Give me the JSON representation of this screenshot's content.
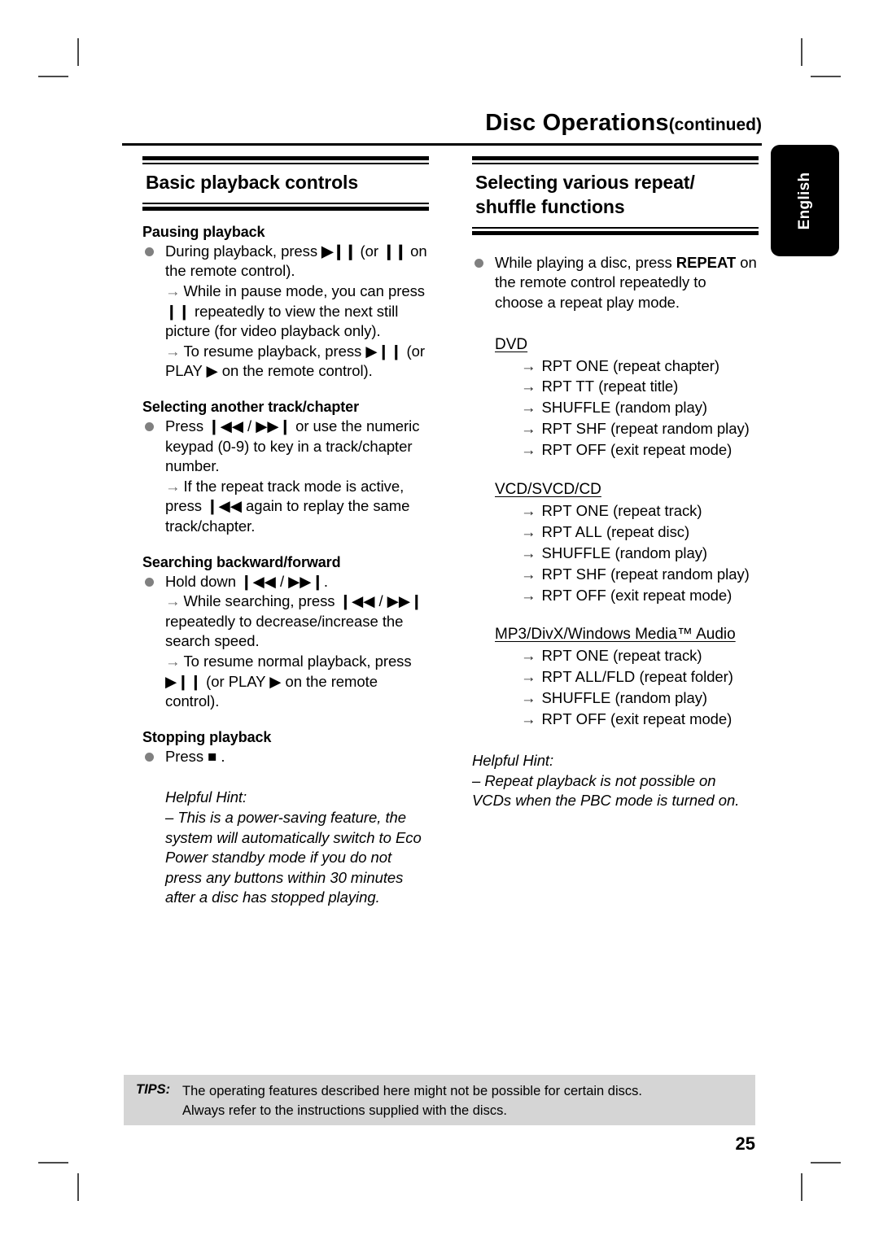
{
  "header": {
    "title_main": "Disc Operations",
    "title_continued": "(continued)"
  },
  "language_tab": {
    "label": "English"
  },
  "left_column": {
    "section_title": "Basic playback controls",
    "blocks": [
      {
        "heading": "Pausing playback",
        "bullet": "During playback, press ▶❙❙ (or ❙❙ on the remote control).",
        "bullet_parts": {
          "t1": "During playback, press ",
          "g1": "▶❙❙",
          "t2": " (or ",
          "g2": "❙❙",
          "t3": " on the remote control)."
        },
        "arrows": [
          "While in pause mode, you can press ❙❙ repeatedly to view the next still picture (for video playback only).",
          "To resume playback, press ▶❙❙ (or PLAY ▶ on the remote control)."
        ]
      },
      {
        "heading": "Selecting another track/chapter",
        "bullet": "Press ❙◀◀ / ▶▶❙ or use the numeric keypad (0-9) to key in a track/chapter number.",
        "arrows": [
          "If the repeat track mode is active, press ❙◀◀ again to replay the same track/chapter."
        ]
      },
      {
        "heading": "Searching backward/forward",
        "bullet": "Hold down ❙◀◀ / ▶▶❙.",
        "arrows": [
          "While searching, press ❙◀◀ / ▶▶❙ repeatedly to decrease/increase the search speed.",
          "To resume normal playback, press ▶❙❙ (or PLAY ▶ on the remote control)."
        ]
      },
      {
        "heading": "Stopping playback",
        "bullet": "Press ■ ."
      }
    ],
    "hint": {
      "label": "Helpful Hint:",
      "text": "– This is a power-saving feature, the system will automatically switch to Eco Power standby mode if you do not press any buttons within 30 minutes after a disc has stopped playing."
    }
  },
  "right_column": {
    "section_title": "Selecting various repeat/ shuffle functions",
    "section_title_line1": "Selecting various repeat/",
    "section_title_line2": "shuffle functions",
    "intro_bullet": {
      "t1": "While playing a disc, press ",
      "key": "REPEAT",
      "t2": " on the remote control repeatedly to choose a repeat play mode."
    },
    "repeat_groups": [
      {
        "disc_type": "DVD",
        "modes": [
          {
            "code": "RPT ONE",
            "desc": "(repeat chapter)"
          },
          {
            "code": "RPT TT",
            "desc": "(repeat title)"
          },
          {
            "code": "SHUFFLE",
            "desc": "(random play)"
          },
          {
            "code": "RPT SHF",
            "desc": "(repeat random play)"
          },
          {
            "code": "RPT OFF",
            "desc": "(exit repeat mode)"
          }
        ]
      },
      {
        "disc_type": "VCD/SVCD/CD",
        "modes": [
          {
            "code": "RPT ONE",
            "desc": "(repeat track)"
          },
          {
            "code": "RPT ALL",
            "desc": "(repeat disc)"
          },
          {
            "code": "SHUFFLE",
            "desc": "(random play)"
          },
          {
            "code": "RPT SHF",
            "desc": "(repeat random play)"
          },
          {
            "code": "RPT OFF",
            "desc": "(exit repeat mode)"
          }
        ]
      },
      {
        "disc_type": "MP3/DivX/Windows Media™ Audio",
        "modes": [
          {
            "code": "RPT ONE",
            "desc": "(repeat track)"
          },
          {
            "code": "RPT ALL/FLD",
            "desc": "(repeat folder)"
          },
          {
            "code": "SHUFFLE",
            "desc": "(random play)"
          },
          {
            "code": "RPT OFF",
            "desc": "(exit repeat mode)"
          }
        ]
      }
    ],
    "hint": {
      "label": "Helpful Hint:",
      "text": "– Repeat playback is not possible on VCDs when the PBC mode is turned on."
    }
  },
  "footer": {
    "tips_label": "TIPS:",
    "tips_line1": "The operating features described here might not be possible for certain discs.",
    "tips_line2": "Always refer to the instructions supplied with the discs.",
    "page_number": "25"
  },
  "glyphs": {
    "play_pause": "▶❙❙",
    "pause": "❙❙",
    "stop": "■",
    "prev": "❙◀◀",
    "next": "▶▶❙",
    "play": "▶",
    "arrow": "→"
  },
  "colors": {
    "bullet": "#808080",
    "tips_background": "#d5d5d5",
    "text": "#000000"
  }
}
